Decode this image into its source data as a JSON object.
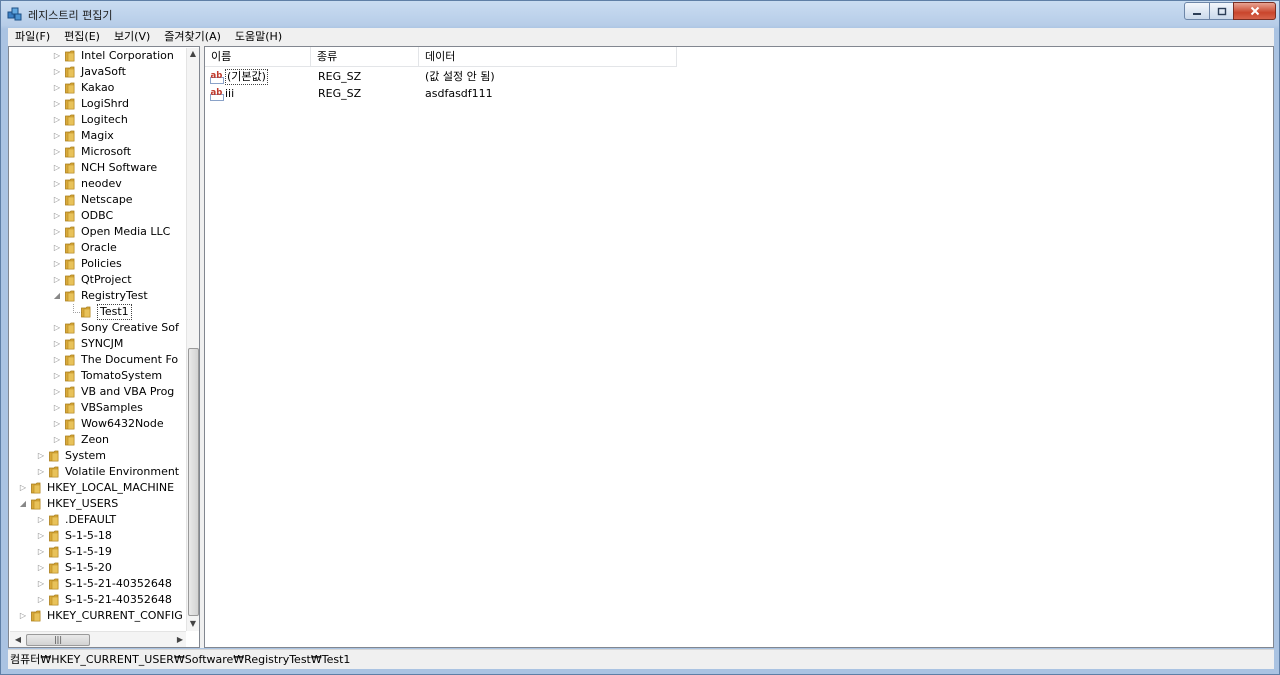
{
  "window": {
    "title": "레지스트리 편집기",
    "controls": {
      "minimize": "–",
      "maximize": "☐",
      "close": "✕"
    }
  },
  "menu": [
    "파일(F)",
    "편집(E)",
    "보기(V)",
    "즐겨찾기(A)",
    "도움말(H)"
  ],
  "tree": {
    "rows": [
      {
        "label": "Intel Corporation",
        "level": 3,
        "expander": "collapsed"
      },
      {
        "label": "JavaSoft",
        "level": 3,
        "expander": "collapsed"
      },
      {
        "label": "Kakao",
        "level": 3,
        "expander": "collapsed"
      },
      {
        "label": "LogiShrd",
        "level": 3,
        "expander": "collapsed"
      },
      {
        "label": "Logitech",
        "level": 3,
        "expander": "collapsed"
      },
      {
        "label": "Magix",
        "level": 3,
        "expander": "collapsed"
      },
      {
        "label": "Microsoft",
        "level": 3,
        "expander": "collapsed"
      },
      {
        "label": "NCH Software",
        "level": 3,
        "expander": "collapsed"
      },
      {
        "label": "neodev",
        "level": 3,
        "expander": "collapsed"
      },
      {
        "label": "Netscape",
        "level": 3,
        "expander": "collapsed"
      },
      {
        "label": "ODBC",
        "level": 3,
        "expander": "collapsed"
      },
      {
        "label": "Open Media LLC",
        "level": 3,
        "expander": "collapsed"
      },
      {
        "label": "Oracle",
        "level": 3,
        "expander": "collapsed"
      },
      {
        "label": "Policies",
        "level": 3,
        "expander": "collapsed"
      },
      {
        "label": "QtProject",
        "level": 3,
        "expander": "collapsed"
      },
      {
        "label": "RegistryTest",
        "level": 3,
        "expander": "expanded"
      },
      {
        "label": "Test1",
        "level": 4,
        "expander": "none",
        "selected": true
      },
      {
        "label": "Sony Creative Sof",
        "level": 3,
        "expander": "collapsed"
      },
      {
        "label": "SYNCJM",
        "level": 3,
        "expander": "collapsed"
      },
      {
        "label": "The Document Fo",
        "level": 3,
        "expander": "collapsed"
      },
      {
        "label": "TomatoSystem",
        "level": 3,
        "expander": "collapsed"
      },
      {
        "label": "VB and VBA Prog",
        "level": 3,
        "expander": "collapsed"
      },
      {
        "label": "VBSamples",
        "level": 3,
        "expander": "collapsed"
      },
      {
        "label": "Wow6432Node",
        "level": 3,
        "expander": "collapsed"
      },
      {
        "label": "Zeon",
        "level": 3,
        "expander": "collapsed"
      },
      {
        "label": "System",
        "level": 2,
        "expander": "collapsed"
      },
      {
        "label": "Volatile Environment",
        "level": 2,
        "expander": "collapsed"
      },
      {
        "label": "HKEY_LOCAL_MACHINE",
        "level": 1,
        "expander": "collapsed"
      },
      {
        "label": "HKEY_USERS",
        "level": 1,
        "expander": "expanded"
      },
      {
        "label": ".DEFAULT",
        "level": 2,
        "expander": "collapsed"
      },
      {
        "label": "S-1-5-18",
        "level": 2,
        "expander": "collapsed"
      },
      {
        "label": "S-1-5-19",
        "level": 2,
        "expander": "collapsed"
      },
      {
        "label": "S-1-5-20",
        "level": 2,
        "expander": "collapsed"
      },
      {
        "label": "S-1-5-21-40352648",
        "level": 2,
        "expander": "collapsed"
      },
      {
        "label": "S-1-5-21-40352648",
        "level": 2,
        "expander": "collapsed"
      },
      {
        "label": "HKEY_CURRENT_CONFIG",
        "level": 1,
        "expander": "collapsed"
      }
    ]
  },
  "list": {
    "columns": [
      "이름",
      "종류",
      "데이터"
    ],
    "rows": [
      {
        "name": "(기본값)",
        "type": "REG_SZ",
        "data": "(값 설정 안 됨)",
        "icon": "string-value-icon",
        "icon_text": "ab",
        "focused": true
      },
      {
        "name": "iii",
        "type": "REG_SZ",
        "data": "asdfasdf111",
        "icon": "string-value-icon",
        "icon_text": "ab"
      }
    ]
  },
  "status": {
    "path": "컴퓨터₩HKEY_CURRENT_USER₩Software₩RegistryTest₩Test1"
  },
  "colors": {
    "folder": "#e8c25a",
    "ab_icon": "#c0392b",
    "title_gradient_top": "#c9dcf1",
    "close_button": "#c9452c"
  }
}
